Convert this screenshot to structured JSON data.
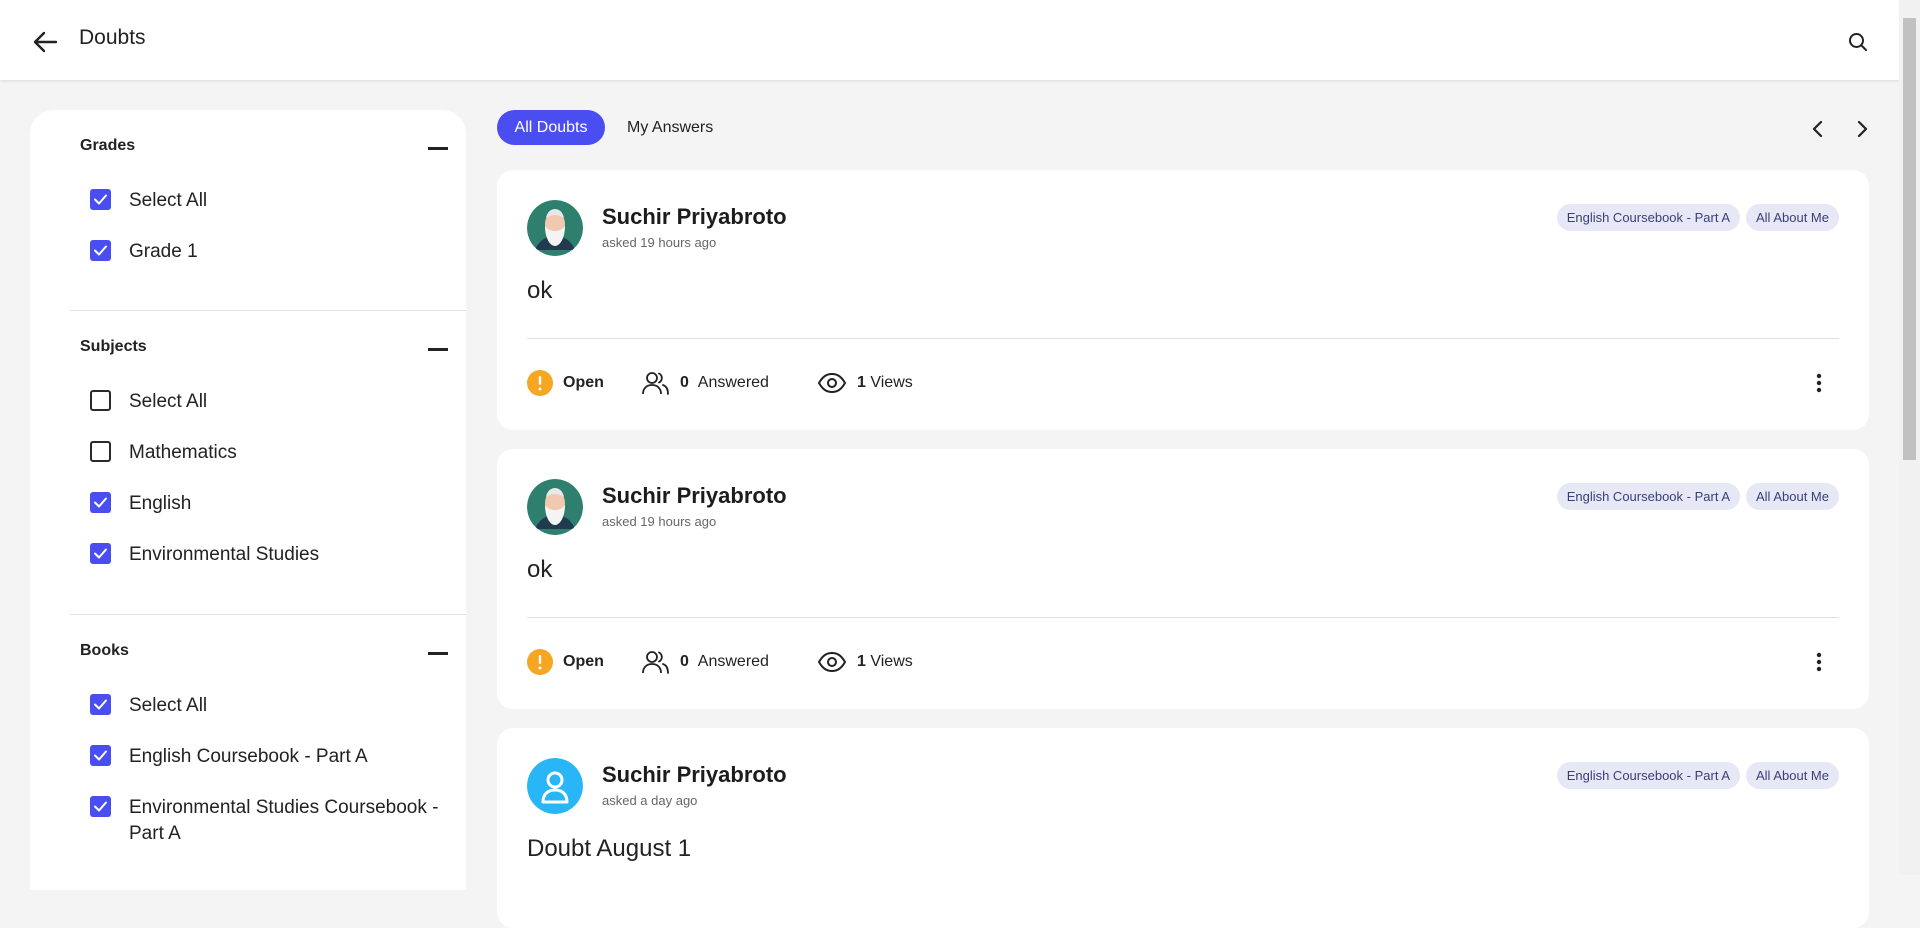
{
  "header": {
    "title": "Doubts"
  },
  "filters": {
    "grades": {
      "title": "Grades",
      "items": [
        {
          "label": "Select All",
          "checked": true
        },
        {
          "label": "Grade 1",
          "checked": true
        }
      ]
    },
    "subjects": {
      "title": "Subjects",
      "items": [
        {
          "label": "Select All",
          "checked": false
        },
        {
          "label": "Mathematics",
          "checked": false
        },
        {
          "label": "English",
          "checked": true
        },
        {
          "label": "Environmental Studies",
          "checked": true
        }
      ]
    },
    "books": {
      "title": "Books",
      "items": [
        {
          "label": "Select All",
          "checked": true
        },
        {
          "label": "English Coursebook - Part A",
          "checked": true
        },
        {
          "label": "Environmental Studies Coursebook - Part A",
          "checked": true
        }
      ]
    }
  },
  "tabs": {
    "all": "All Doubts",
    "mine": "My Answers"
  },
  "doubts": [
    {
      "author": "Suchir Priyabroto",
      "asked": "asked 19 hours ago",
      "tags": [
        "English Coursebook - Part A",
        "All About Me"
      ],
      "text": "ok",
      "status": "Open",
      "answered_count": "0",
      "answered_label": "Answered",
      "views_count": "1",
      "views_label": "Views",
      "avatar": "old-man-avatar"
    },
    {
      "author": "Suchir Priyabroto",
      "asked": "asked 19 hours ago",
      "tags": [
        "English Coursebook - Part A",
        "All About Me"
      ],
      "text": "ok",
      "status": "Open",
      "answered_count": "0",
      "answered_label": "Answered",
      "views_count": "1",
      "views_label": "Views",
      "avatar": "old-man-avatar"
    },
    {
      "author": "Suchir Priyabroto",
      "asked": "asked a day ago",
      "tags": [
        "English Coursebook - Part A",
        "All About Me"
      ],
      "text": "Doubt August 1",
      "avatar": "default-user-avatar"
    }
  ],
  "colors": {
    "accent": "#4a4ef0",
    "open_status": "#f5a623",
    "avatar_teal": "#2e7f6e",
    "avatar_blue": "#29b6f6"
  }
}
